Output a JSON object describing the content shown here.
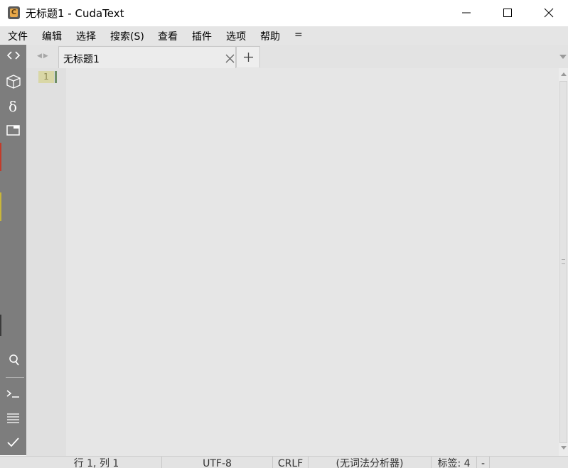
{
  "window": {
    "title": "无标题1 - CudaText",
    "app_icon_letter": "C"
  },
  "menu": {
    "items": [
      "文件",
      "编辑",
      "选择",
      "搜索(S)",
      "查看",
      "插件",
      "选项",
      "帮助",
      "="
    ]
  },
  "sidebar": {
    "top_buttons": [
      "code-tree-icon",
      "project-box-icon",
      "delta-icon",
      "tabs-panel-icon"
    ],
    "bottom_buttons": [
      "search-icon",
      "console-icon",
      "output-list-icon",
      "validate-check-icon"
    ]
  },
  "tabs": {
    "items": [
      {
        "label": "无标题1",
        "active": true
      }
    ],
    "add_label": "+"
  },
  "editor": {
    "line_numbers": [
      "1"
    ],
    "content": ""
  },
  "status": {
    "position": "行 1, 列 1",
    "encoding": "UTF-8",
    "line_ending": "CRLF",
    "lexer": "(无词法分析器)",
    "tab_size": "标签: 4",
    "extra": "-"
  },
  "colors": {
    "sidebar": "#7d7d7d",
    "editor_bg": "#e6e6e6",
    "line_number_highlight": "#d9d7a6",
    "caret": "#6f8f67"
  }
}
